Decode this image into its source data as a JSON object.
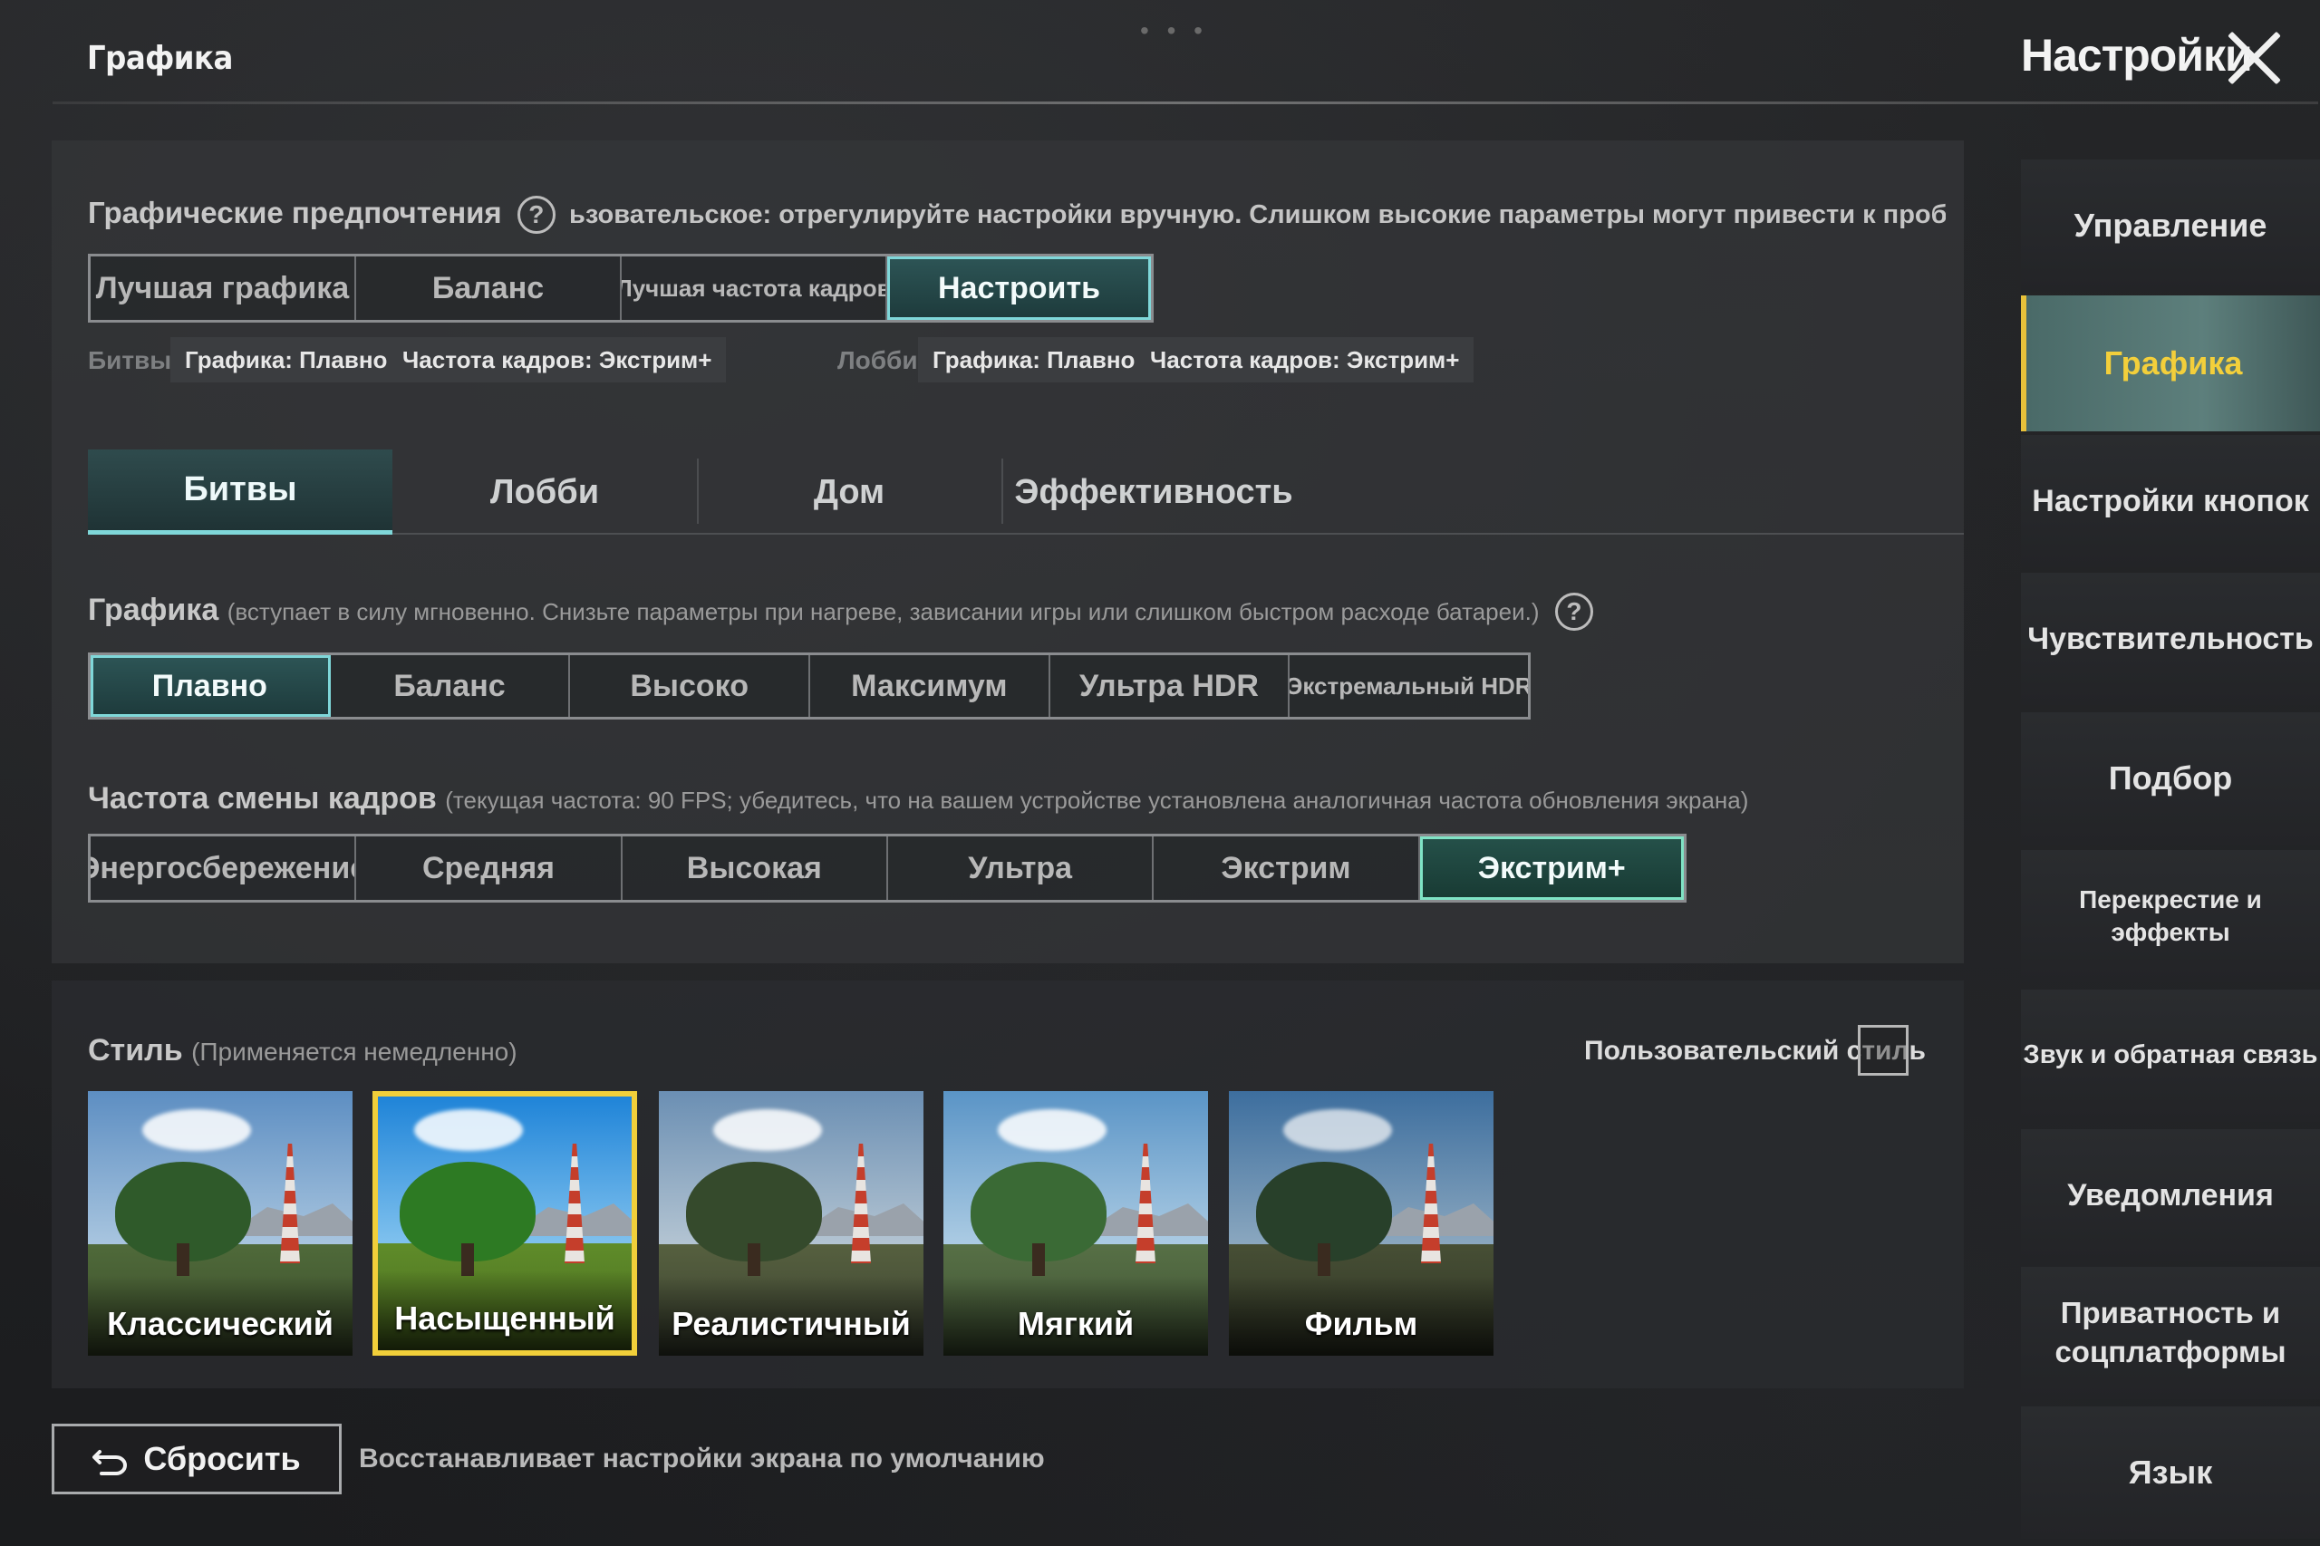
{
  "header": {
    "section_title": "Графика",
    "settings_title": "Настройки",
    "dots": "• • •"
  },
  "preferences": {
    "label": "Графические предпочтения",
    "description": "ьзовательское: отрегулируйте настройки вручную. Слишком высокие параметры могут привести к проблемам с производительнос",
    "options": [
      "Лучшая графика",
      "Баланс",
      "Лучшая частота кадров",
      "Настроить"
    ],
    "selected": "Настроить"
  },
  "summary": {
    "battle_label": "Битвы",
    "battle_chips": [
      "Графика: Плавно",
      "Частота кадров: Экстрим+"
    ],
    "lobby_label": "Лобби",
    "lobby_chips": [
      "Графика: Плавно",
      "Частота кадров: Экстрим+"
    ]
  },
  "tabs": [
    "Битвы",
    "Лобби",
    "Дом",
    "Эффективность"
  ],
  "graphics": {
    "label": "Графика",
    "hint": "(вступает в силу мгновенно. Снизьте параметры при нагреве, зависании игры или слишком быстром расходе батареи.)",
    "options": [
      "Плавно",
      "Баланс",
      "Высоко",
      "Максимум",
      "Ультра HDR",
      "Экстремальный HDR"
    ],
    "selected": "Плавно"
  },
  "framerate": {
    "label": "Частота смены кадров",
    "hint": "(текущая частота: 90 FPS; убедитесь, что на вашем устройстве установлена аналогичная частота обновления экрана)",
    "options": [
      "Энергосбережение",
      "Средняя",
      "Высокая",
      "Ультра",
      "Экстрим",
      "Экстрим+"
    ],
    "selected": "Экстрим+"
  },
  "style": {
    "label": "Стиль",
    "hint": "(Применяется немедленно)",
    "custom_label": "Пользовательский стиль",
    "cards": [
      "Классический",
      "Насыщенный",
      "Реалистичный",
      "Мягкий",
      "Фильм"
    ],
    "selected": "Насыщенный"
  },
  "reset": {
    "label": "Сбросить",
    "description": "Восстанавливает настройки экрана по умолчанию"
  },
  "sidebar": {
    "items": [
      "Управление",
      "Графика",
      "Настройки кнопок",
      "Чувствительность",
      "Подбор",
      "Перекрестие и эффекты",
      "Звук и обратная связь",
      "Уведомления",
      "Приватность и соцплатформы",
      "Язык"
    ],
    "active": "Графика"
  },
  "colors": {
    "accent_teal": "#7fd7d9",
    "accent_yellow": "#f1cf3a"
  }
}
